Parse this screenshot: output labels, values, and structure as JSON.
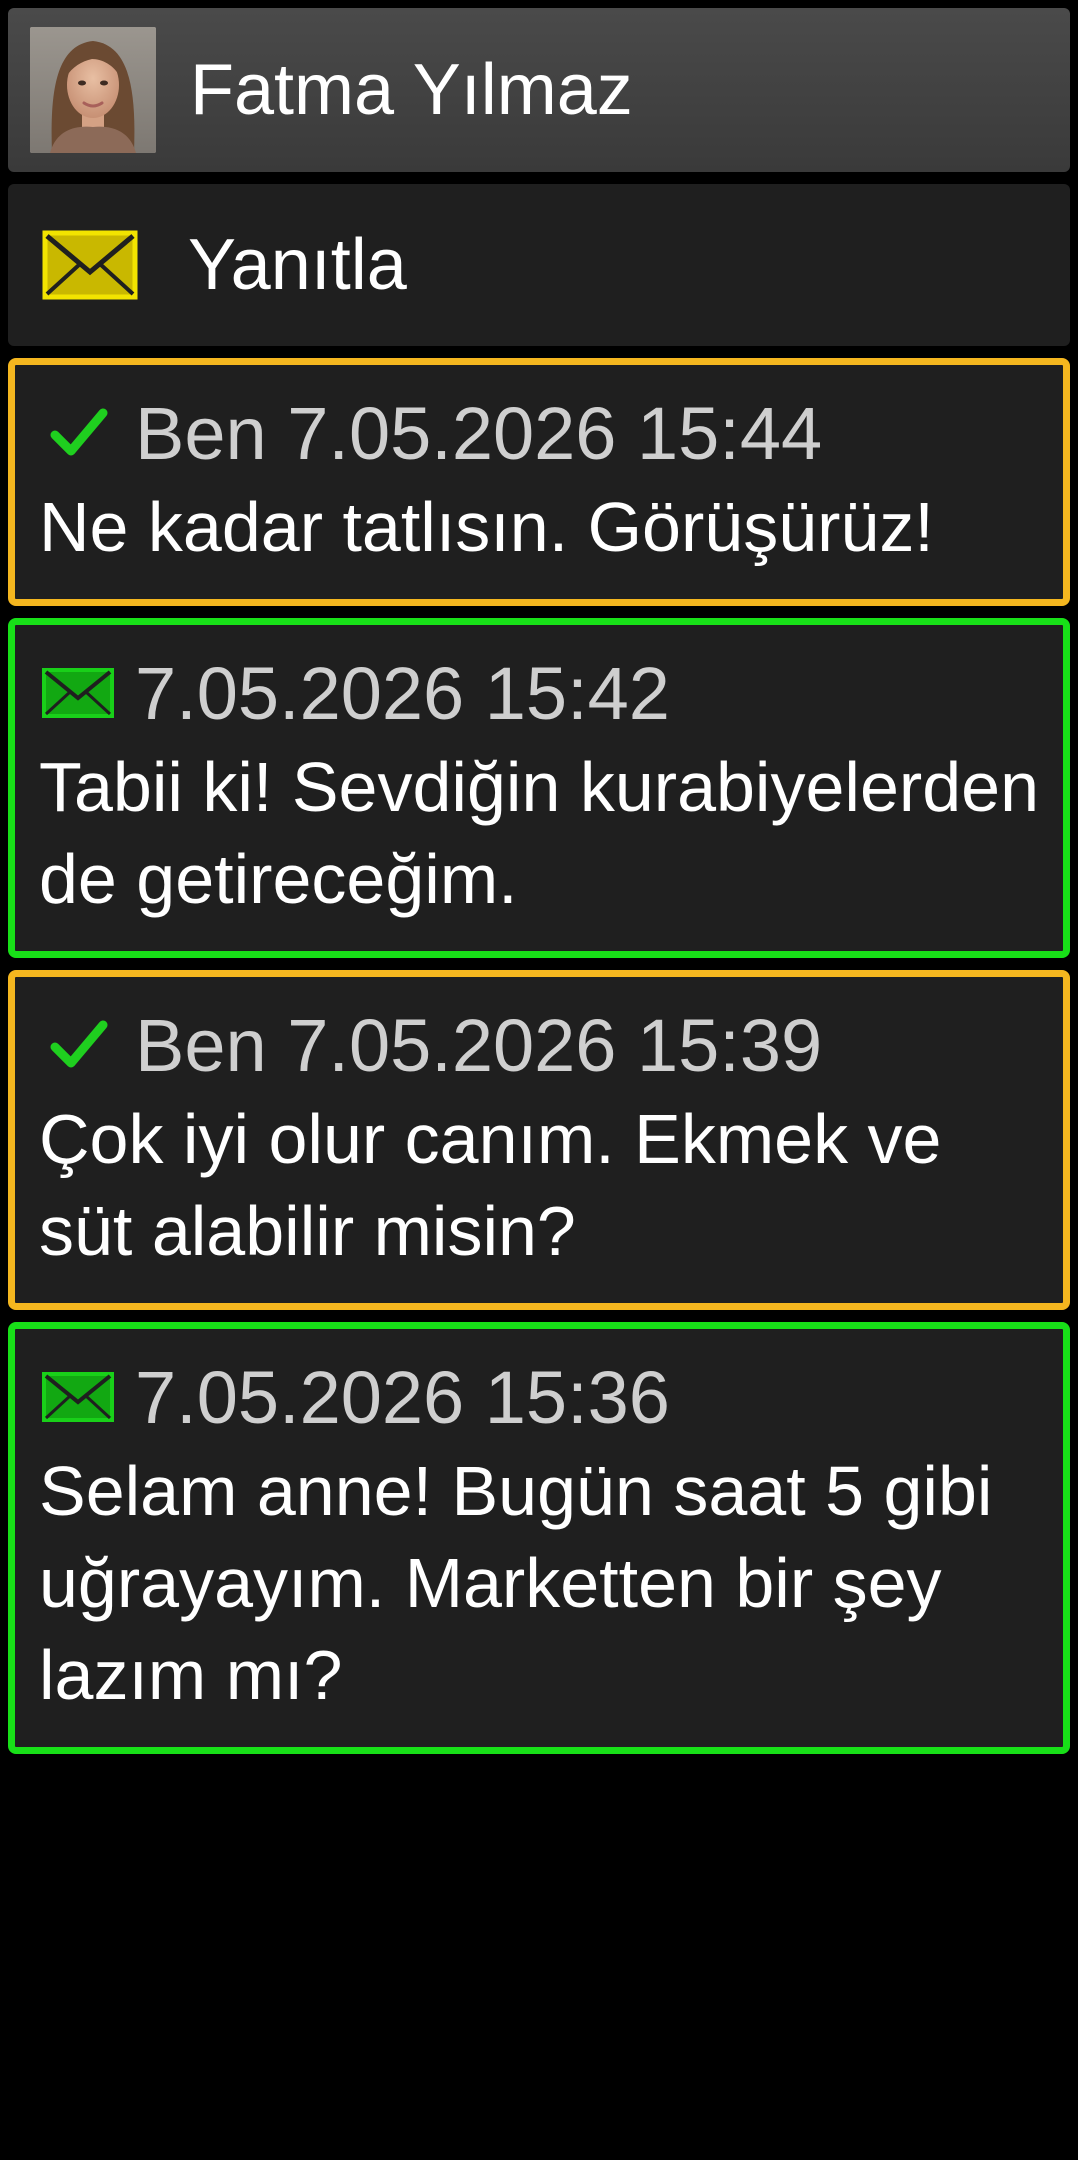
{
  "header": {
    "contact_name": "Fatma Yılmaz",
    "avatar_icon": "contact-photo"
  },
  "actions": {
    "reply_label": "Yanıtla",
    "reply_icon": "envelope-icon",
    "reply_icon_color": "#f2e400"
  },
  "colors": {
    "outgoing_border": "#f4b61f",
    "incoming_border": "#18e018",
    "checkmark": "#1fcf1f",
    "incoming_icon": "#19d019",
    "card_background": "#1f1f1f"
  },
  "messages": [
    {
      "direction": "outgoing",
      "status_icon": "checkmark-icon",
      "meta": "Ben 7.05.2026 15:44",
      "text": "Ne kadar tatlısın. Görüşürüz!"
    },
    {
      "direction": "incoming",
      "status_icon": "envelope-icon",
      "meta": "7.05.2026 15:42",
      "text": "Tabii ki! Sevdiğin kurabiyelerden de getireceğim."
    },
    {
      "direction": "outgoing",
      "status_icon": "checkmark-icon",
      "meta": "Ben 7.05.2026 15:39",
      "text": "Çok iyi olur canım. Ekmek ve süt alabilir misin?"
    },
    {
      "direction": "incoming",
      "status_icon": "envelope-icon",
      "meta": "7.05.2026 15:36",
      "text": "Selam anne! Bugün saat 5 gibi uğrayayım. Marketten bir şey lazım mı?"
    }
  ]
}
